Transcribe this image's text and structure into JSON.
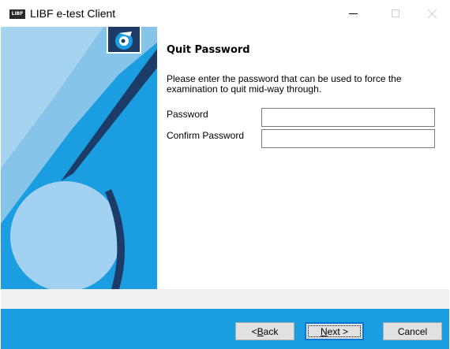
{
  "window": {
    "title": "LIBF e-test Client",
    "logo_text": "LIBF"
  },
  "page": {
    "title": "Quit Password",
    "description": "Please enter the password that can be used to force the examination to quit mid-way through."
  },
  "form": {
    "password_label": "Password",
    "password_value": "",
    "confirm_label": "Confirm Password",
    "confirm_value": ""
  },
  "buttons": {
    "back_prefix": "< ",
    "back_mnemonic": "B",
    "back_rest": "ack",
    "next_mnemonic": "N",
    "next_rest": "ext >",
    "cancel": "Cancel"
  },
  "colors": {
    "banner_blue": "#1b9de2",
    "banner_light": "#7fc3ec",
    "footer_blue": "#1b9de2",
    "stripe_dark": "#1c3b66"
  }
}
